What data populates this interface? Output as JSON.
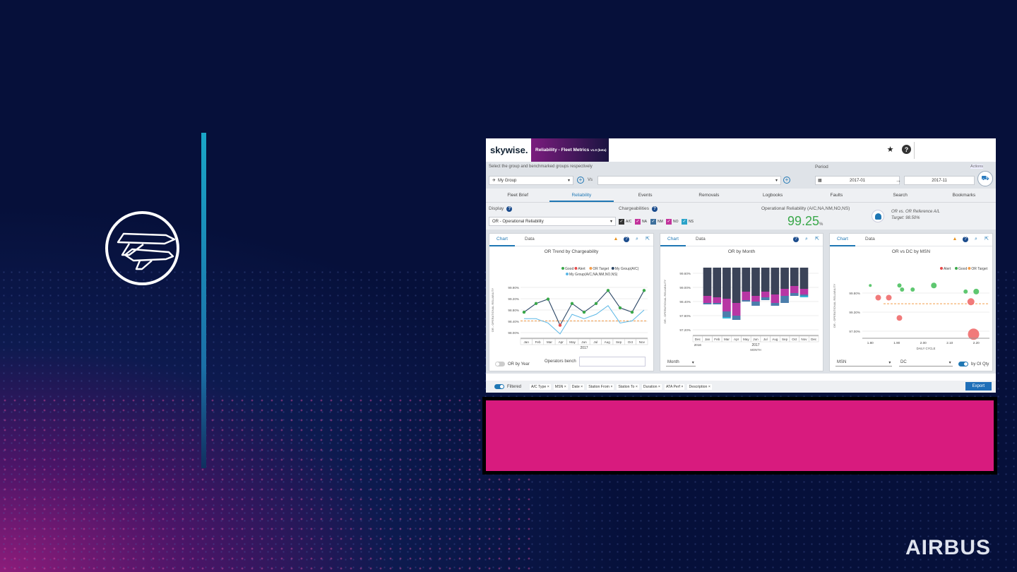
{
  "brand": {
    "name": "AIRBUS"
  },
  "app": {
    "logo": "skywise.",
    "title": "Reliability - Fleet Metrics",
    "version": "v1.0 (beta)",
    "filter": {
      "hint": "Select the group and benchmarked groups respectively",
      "group": "My Group",
      "vs_label": "Vs",
      "vs_value": "",
      "period_label": "Period",
      "period_from": "2017-01",
      "period_arrow": "→",
      "period_to": "2017-11",
      "actions": "Actions"
    },
    "tabs": [
      "Fleet Brief",
      "Reliability",
      "Events",
      "Removals",
      "Logbooks",
      "Faults",
      "Search",
      "Bookmarks"
    ],
    "active_tab": "Reliability",
    "display": {
      "label": "Display",
      "value": "OR - Operational Reliability"
    },
    "chargeabilities": {
      "label": "Chargeabilities",
      "items": [
        {
          "label": "A/C",
          "color": "#333333"
        },
        {
          "label": "NA",
          "color": "#c2339b"
        },
        {
          "label": "NM",
          "color": "#3d6f9c"
        },
        {
          "label": "NO",
          "color": "#c2339b"
        },
        {
          "label": "NS",
          "color": "#2aa3c9"
        }
      ]
    },
    "or_summary": {
      "label": "Operational Reliability (A/C,NA,NM,NO,NS)",
      "value": "99.25",
      "unit": "%",
      "ref_line1": "OR vs. OR Reference A/L",
      "ref_line2": "Target: 98.50%"
    },
    "panels": [
      {
        "tabs": [
          "Chart",
          "Data"
        ],
        "title": "OR Trend by Chargeability",
        "legend": [
          "Good",
          "Alert",
          "OR Target",
          "My Group(A/C)",
          "My Group(A/C,NA,NM,NO,NS)"
        ],
        "ylabel": "OR - OPERATIONAL RELIABILITY",
        "xyear": "2017",
        "footer_toggle": "OR by Year",
        "footer_field": "Operators bench"
      },
      {
        "tabs": [
          "Chart",
          "Data"
        ],
        "title": "OR by Month",
        "ylabel": "OR - OPERATIONAL RELIABILITY",
        "xyear_left": "2016",
        "xyear": "2017",
        "xlabel": "MONTH",
        "footer_select": "Month"
      },
      {
        "tabs": [
          "Chart",
          "Data"
        ],
        "title": "OR vs DC by MSN",
        "legend": [
          "Alert",
          "Good",
          "OR Target"
        ],
        "ylabel": "OR - OPERATIONAL RELIABILITY",
        "xlabel": "DAILY CYCLE",
        "footer_select1": "MSN",
        "footer_select2": "DC",
        "footer_toggle": "by OI Qty"
      }
    ],
    "footer": {
      "toggle_label": "Filtered",
      "chips": [
        "A/C Type",
        "MSN",
        "Date",
        "Station From",
        "Station To",
        "Duration",
        "ATA Perf",
        "Description"
      ],
      "export": "Export"
    }
  },
  "chart_data": [
    {
      "type": "line",
      "title": "OR Trend by Chargeability",
      "categories": [
        "Jan",
        "Feb",
        "Mar",
        "Apr",
        "May",
        "Jun",
        "Jul",
        "Aug",
        "Sep",
        "Oct",
        "Nov"
      ],
      "series": [
        {
          "name": "My Group(A/C)",
          "values": [
            99.8,
            100.0,
            100.1,
            99.5,
            100.0,
            99.8,
            100.0,
            100.3,
            99.9,
            99.8,
            100.3
          ]
        },
        {
          "name": "My Group(A/C,NA,NM,NO,NS)",
          "values": [
            99.65,
            99.65,
            99.55,
            99.3,
            99.75,
            99.65,
            99.75,
            99.95,
            99.55,
            99.6,
            99.85
          ]
        }
      ],
      "status": [
        "good",
        "good",
        "good",
        "alert",
        "good",
        "good",
        "good",
        "good",
        "good",
        "good",
        "good"
      ],
      "target": 99.6,
      "yticks": [
        "99.90%",
        "99.20%",
        "98.80%",
        "98.40%",
        "98.00%"
      ],
      "xyear": "2017"
    },
    {
      "type": "bar",
      "title": "OR by Month",
      "categories": [
        "Dec",
        "Jan",
        "Feb",
        "Mar",
        "Apr",
        "May",
        "Jun",
        "Jul",
        "Aug",
        "Sep",
        "Oct",
        "Nov",
        "Dec"
      ],
      "yticks": [
        "99.60%",
        "99.00%",
        "98.40%",
        "97.80%",
        "97.20%"
      ],
      "series": [
        {
          "name": "A/C",
          "color": "#3b4358",
          "values": [
            0,
            1.0,
            1.05,
            1.1,
            1.25,
            0.85,
            1.0,
            0.85,
            0.95,
            0.75,
            0.65,
            0.75,
            0
          ]
        },
        {
          "name": "NA",
          "color": "#b836a4",
          "values": [
            0,
            0.25,
            0.2,
            0.45,
            0.45,
            0.3,
            0.2,
            0.2,
            0.3,
            0.25,
            0.25,
            0.2,
            0
          ]
        },
        {
          "name": "NM",
          "color": "#4c7dab",
          "values": [
            0,
            0.05,
            0.05,
            0.2,
            0.15,
            0.05,
            0.15,
            0.1,
            0.1,
            0.25,
            0.1,
            0.05,
            0
          ]
        },
        {
          "name": "NS",
          "color": "#35b6d6",
          "values": [
            0,
            0.0,
            0.0,
            0.05,
            0.0,
            0.0,
            0.0,
            0.0,
            0.0,
            0.0,
            0.0,
            0.05,
            0
          ]
        }
      ]
    },
    {
      "type": "scatter",
      "title": "OR vs DC by MSN",
      "xticks": [
        "1.80",
        "1.90",
        "2.00",
        "2.10",
        "2.20"
      ],
      "yticks": [
        "99.80%",
        "99.30%",
        "97.00%"
      ],
      "target": 99.05,
      "points": [
        {
          "x": 1.8,
          "y": 99.5,
          "status": "good",
          "r": 2
        },
        {
          "x": 1.83,
          "y": 99.2,
          "status": "alert",
          "r": 4
        },
        {
          "x": 1.87,
          "y": 99.2,
          "status": "alert",
          "r": 4
        },
        {
          "x": 1.91,
          "y": 99.5,
          "status": "good",
          "r": 3
        },
        {
          "x": 1.92,
          "y": 99.4,
          "status": "good",
          "r": 3
        },
        {
          "x": 1.96,
          "y": 99.4,
          "status": "good",
          "r": 3
        },
        {
          "x": 2.04,
          "y": 99.5,
          "status": "good",
          "r": 4
        },
        {
          "x": 2.16,
          "y": 99.35,
          "status": "good",
          "r": 3
        },
        {
          "x": 2.2,
          "y": 99.35,
          "status": "good",
          "r": 4
        },
        {
          "x": 1.91,
          "y": 98.7,
          "status": "alert",
          "r": 4
        },
        {
          "x": 2.18,
          "y": 99.1,
          "status": "alert",
          "r": 5
        },
        {
          "x": 2.19,
          "y": 98.3,
          "status": "alert",
          "r": 8
        }
      ]
    }
  ]
}
